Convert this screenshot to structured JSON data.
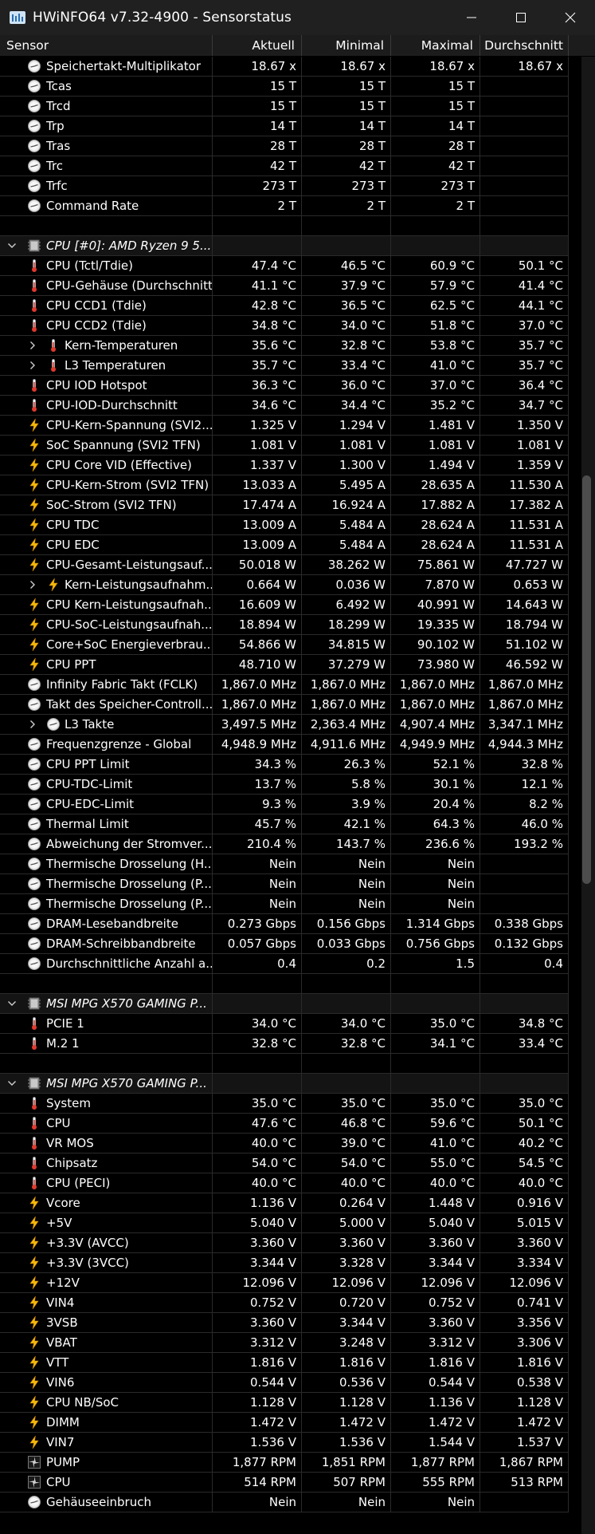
{
  "window": {
    "title": "HWiNFO64 v7.32-4900 - Sensorstatus"
  },
  "columns": [
    "Sensor",
    "Aktuell",
    "Minimal",
    "Maximal",
    "Durchschnitt"
  ],
  "rows": [
    {
      "type": "item",
      "icon": "gauge",
      "label": "Speichertakt-Multiplikator",
      "cur": "18.67 x",
      "min": "18.67 x",
      "max": "18.67 x",
      "avg": "18.67 x"
    },
    {
      "type": "item",
      "icon": "gauge",
      "label": "Tcas",
      "cur": "15 T",
      "min": "15 T",
      "max": "15 T",
      "avg": ""
    },
    {
      "type": "item",
      "icon": "gauge",
      "label": "Trcd",
      "cur": "15 T",
      "min": "15 T",
      "max": "15 T",
      "avg": ""
    },
    {
      "type": "item",
      "icon": "gauge",
      "label": "Trp",
      "cur": "14 T",
      "min": "14 T",
      "max": "14 T",
      "avg": ""
    },
    {
      "type": "item",
      "icon": "gauge",
      "label": "Tras",
      "cur": "28 T",
      "min": "28 T",
      "max": "28 T",
      "avg": ""
    },
    {
      "type": "item",
      "icon": "gauge",
      "label": "Trc",
      "cur": "42 T",
      "min": "42 T",
      "max": "42 T",
      "avg": ""
    },
    {
      "type": "item",
      "icon": "gauge",
      "label": "Trfc",
      "cur": "273 T",
      "min": "273 T",
      "max": "273 T",
      "avg": ""
    },
    {
      "type": "item",
      "icon": "gauge",
      "label": "Command Rate",
      "cur": "2 T",
      "min": "2 T",
      "max": "2 T",
      "avg": ""
    },
    {
      "type": "blank"
    },
    {
      "type": "group",
      "label": "CPU [#0]: AMD Ryzen 9 5..."
    },
    {
      "type": "item",
      "icon": "thermo",
      "label": "CPU (Tctl/Tdie)",
      "cur": "47.4 °C",
      "min": "46.5 °C",
      "max": "60.9 °C",
      "avg": "50.1 °C"
    },
    {
      "type": "item",
      "icon": "thermo",
      "label": "CPU-Gehäuse (Durchschnitt)",
      "cur": "41.1 °C",
      "min": "37.9 °C",
      "max": "57.9 °C",
      "avg": "41.4 °C"
    },
    {
      "type": "item",
      "icon": "thermo",
      "label": "CPU CCD1 (Tdie)",
      "cur": "42.8 °C",
      "min": "36.5 °C",
      "max": "62.5 °C",
      "avg": "44.1 °C"
    },
    {
      "type": "item",
      "icon": "thermo",
      "label": "CPU CCD2 (Tdie)",
      "cur": "34.8 °C",
      "min": "34.0 °C",
      "max": "51.8 °C",
      "avg": "37.0 °C"
    },
    {
      "type": "item",
      "icon": "thermo",
      "label": "Kern-Temperaturen",
      "sub": true,
      "cur": "35.6 °C",
      "min": "32.8 °C",
      "max": "53.8 °C",
      "avg": "35.7 °C"
    },
    {
      "type": "item",
      "icon": "thermo",
      "label": "L3 Temperaturen",
      "sub": true,
      "cur": "35.7 °C",
      "min": "33.4 °C",
      "max": "41.0 °C",
      "avg": "35.7 °C"
    },
    {
      "type": "item",
      "icon": "thermo",
      "label": "CPU IOD Hotspot",
      "cur": "36.3 °C",
      "min": "36.0 °C",
      "max": "37.0 °C",
      "avg": "36.4 °C"
    },
    {
      "type": "item",
      "icon": "thermo",
      "label": "CPU-IOD-Durchschnitt",
      "cur": "34.6 °C",
      "min": "34.4 °C",
      "max": "35.2 °C",
      "avg": "34.7 °C"
    },
    {
      "type": "item",
      "icon": "bolt",
      "label": "CPU-Kern-Spannung (SVI2...",
      "cur": "1.325 V",
      "min": "1.294 V",
      "max": "1.481 V",
      "avg": "1.350 V"
    },
    {
      "type": "item",
      "icon": "bolt",
      "label": "SoC Spannung (SVI2 TFN)",
      "cur": "1.081 V",
      "min": "1.081 V",
      "max": "1.081 V",
      "avg": "1.081 V"
    },
    {
      "type": "item",
      "icon": "bolt",
      "label": "CPU Core VID (Effective)",
      "cur": "1.337 V",
      "min": "1.300 V",
      "max": "1.494 V",
      "avg": "1.359 V"
    },
    {
      "type": "item",
      "icon": "bolt",
      "label": "CPU-Kern-Strom (SVI2 TFN)",
      "cur": "13.033 A",
      "min": "5.495 A",
      "max": "28.635 A",
      "avg": "11.530 A"
    },
    {
      "type": "item",
      "icon": "bolt",
      "label": "SoC-Strom (SVI2 TFN)",
      "cur": "17.474 A",
      "min": "16.924 A",
      "max": "17.882 A",
      "avg": "17.382 A"
    },
    {
      "type": "item",
      "icon": "bolt",
      "label": "CPU TDC",
      "cur": "13.009 A",
      "min": "5.484 A",
      "max": "28.624 A",
      "avg": "11.531 A"
    },
    {
      "type": "item",
      "icon": "bolt",
      "label": "CPU EDC",
      "cur": "13.009 A",
      "min": "5.484 A",
      "max": "28.624 A",
      "avg": "11.531 A"
    },
    {
      "type": "item",
      "icon": "bolt",
      "label": "CPU-Gesamt-Leistungsauf...",
      "cur": "50.018 W",
      "min": "38.262 W",
      "max": "75.861 W",
      "avg": "47.727 W"
    },
    {
      "type": "item",
      "icon": "bolt",
      "label": "Kern-Leistungsaufnahm...",
      "sub": true,
      "cur": "0.664 W",
      "min": "0.036 W",
      "max": "7.870 W",
      "avg": "0.653 W"
    },
    {
      "type": "item",
      "icon": "bolt",
      "label": "CPU Kern-Leistungsaufnah...",
      "cur": "16.609 W",
      "min": "6.492 W",
      "max": "40.991 W",
      "avg": "14.643 W"
    },
    {
      "type": "item",
      "icon": "bolt",
      "label": "CPU-SoC-Leistungsaufnah...",
      "cur": "18.894 W",
      "min": "18.299 W",
      "max": "19.335 W",
      "avg": "18.794 W"
    },
    {
      "type": "item",
      "icon": "bolt",
      "label": "Core+SoC Energieverbrau...",
      "cur": "54.866 W",
      "min": "34.815 W",
      "max": "90.102 W",
      "avg": "51.102 W"
    },
    {
      "type": "item",
      "icon": "bolt",
      "label": "CPU PPT",
      "cur": "48.710 W",
      "min": "37.279 W",
      "max": "73.980 W",
      "avg": "46.592 W"
    },
    {
      "type": "item",
      "icon": "gauge",
      "label": "Infinity Fabric Takt (FCLK)",
      "cur": "1,867.0 MHz",
      "min": "1,867.0 MHz",
      "max": "1,867.0 MHz",
      "avg": "1,867.0 MHz"
    },
    {
      "type": "item",
      "icon": "gauge",
      "label": "Takt des Speicher-Controll...",
      "cur": "1,867.0 MHz",
      "min": "1,867.0 MHz",
      "max": "1,867.0 MHz",
      "avg": "1,867.0 MHz"
    },
    {
      "type": "item",
      "icon": "gauge",
      "label": "L3 Takte",
      "sub": true,
      "cur": "3,497.5 MHz",
      "min": "2,363.4 MHz",
      "max": "4,907.4 MHz",
      "avg": "3,347.1 MHz"
    },
    {
      "type": "item",
      "icon": "gauge",
      "label": "Frequenzgrenze - Global",
      "cur": "4,948.9 MHz",
      "min": "4,911.6 MHz",
      "max": "4,949.9 MHz",
      "avg": "4,944.3 MHz"
    },
    {
      "type": "item",
      "icon": "gauge",
      "label": "CPU PPT Limit",
      "cur": "34.3 %",
      "min": "26.3 %",
      "max": "52.1 %",
      "avg": "32.8 %"
    },
    {
      "type": "item",
      "icon": "gauge",
      "label": "CPU-TDC-Limit",
      "cur": "13.7 %",
      "min": "5.8 %",
      "max": "30.1 %",
      "avg": "12.1 %"
    },
    {
      "type": "item",
      "icon": "gauge",
      "label": "CPU-EDC-Limit",
      "cur": "9.3 %",
      "min": "3.9 %",
      "max": "20.4 %",
      "avg": "8.2 %"
    },
    {
      "type": "item",
      "icon": "gauge",
      "label": "Thermal Limit",
      "cur": "45.7 %",
      "min": "42.1 %",
      "max": "64.3 %",
      "avg": "46.0 %"
    },
    {
      "type": "item",
      "icon": "gauge",
      "label": "Abweichung der Stromver...",
      "cur": "210.4 %",
      "min": "143.7 %",
      "max": "236.6 %",
      "avg": "193.2 %"
    },
    {
      "type": "item",
      "icon": "gauge",
      "label": "Thermische Drosselung (H...",
      "cur": "Nein",
      "min": "Nein",
      "max": "Nein",
      "avg": ""
    },
    {
      "type": "item",
      "icon": "gauge",
      "label": "Thermische Drosselung (P...",
      "cur": "Nein",
      "min": "Nein",
      "max": "Nein",
      "avg": ""
    },
    {
      "type": "item",
      "icon": "gauge",
      "label": "Thermische Drosselung (P...",
      "cur": "Nein",
      "min": "Nein",
      "max": "Nein",
      "avg": ""
    },
    {
      "type": "item",
      "icon": "gauge",
      "label": "DRAM-Lesebandbreite",
      "cur": "0.273 Gbps",
      "min": "0.156 Gbps",
      "max": "1.314 Gbps",
      "avg": "0.338 Gbps"
    },
    {
      "type": "item",
      "icon": "gauge",
      "label": "DRAM-Schreibbandbreite",
      "cur": "0.057 Gbps",
      "min": "0.033 Gbps",
      "max": "0.756 Gbps",
      "avg": "0.132 Gbps"
    },
    {
      "type": "item",
      "icon": "gauge",
      "label": "Durchschnittliche Anzahl a...",
      "cur": "0.4",
      "min": "0.2",
      "max": "1.5",
      "avg": "0.4"
    },
    {
      "type": "blank"
    },
    {
      "type": "group",
      "label": "MSI MPG X570 GAMING P..."
    },
    {
      "type": "item",
      "icon": "thermo",
      "label": "PCIE 1",
      "cur": "34.0 °C",
      "min": "34.0 °C",
      "max": "35.0 °C",
      "avg": "34.8 °C"
    },
    {
      "type": "item",
      "icon": "thermo",
      "label": "M.2 1",
      "cur": "32.8 °C",
      "min": "32.8 °C",
      "max": "34.1 °C",
      "avg": "33.4 °C"
    },
    {
      "type": "blank"
    },
    {
      "type": "group",
      "label": "MSI MPG X570 GAMING P..."
    },
    {
      "type": "item",
      "icon": "thermo",
      "label": "System",
      "cur": "35.0 °C",
      "min": "35.0 °C",
      "max": "35.0 °C",
      "avg": "35.0 °C"
    },
    {
      "type": "item",
      "icon": "thermo",
      "label": "CPU",
      "cur": "47.6 °C",
      "min": "46.8 °C",
      "max": "59.6 °C",
      "avg": "50.1 °C"
    },
    {
      "type": "item",
      "icon": "thermo",
      "label": "VR MOS",
      "cur": "40.0 °C",
      "min": "39.0 °C",
      "max": "41.0 °C",
      "avg": "40.2 °C"
    },
    {
      "type": "item",
      "icon": "thermo",
      "label": "Chipsatz",
      "cur": "54.0 °C",
      "min": "54.0 °C",
      "max": "55.0 °C",
      "avg": "54.5 °C"
    },
    {
      "type": "item",
      "icon": "thermo",
      "label": "CPU (PECI)",
      "cur": "40.0 °C",
      "min": "40.0 °C",
      "max": "40.0 °C",
      "avg": "40.0 °C"
    },
    {
      "type": "item",
      "icon": "bolt",
      "label": "Vcore",
      "cur": "1.136 V",
      "min": "0.264 V",
      "max": "1.448 V",
      "avg": "0.916 V"
    },
    {
      "type": "item",
      "icon": "bolt",
      "label": "+5V",
      "cur": "5.040 V",
      "min": "5.000 V",
      "max": "5.040 V",
      "avg": "5.015 V"
    },
    {
      "type": "item",
      "icon": "bolt",
      "label": "+3.3V (AVCC)",
      "cur": "3.360 V",
      "min": "3.360 V",
      "max": "3.360 V",
      "avg": "3.360 V"
    },
    {
      "type": "item",
      "icon": "bolt",
      "label": "+3.3V (3VCC)",
      "cur": "3.344 V",
      "min": "3.328 V",
      "max": "3.344 V",
      "avg": "3.334 V"
    },
    {
      "type": "item",
      "icon": "bolt",
      "label": "+12V",
      "cur": "12.096 V",
      "min": "12.096 V",
      "max": "12.096 V",
      "avg": "12.096 V"
    },
    {
      "type": "item",
      "icon": "bolt",
      "label": "VIN4",
      "cur": "0.752 V",
      "min": "0.720 V",
      "max": "0.752 V",
      "avg": "0.741 V"
    },
    {
      "type": "item",
      "icon": "bolt",
      "label": "3VSB",
      "cur": "3.360 V",
      "min": "3.344 V",
      "max": "3.360 V",
      "avg": "3.356 V"
    },
    {
      "type": "item",
      "icon": "bolt",
      "label": "VBAT",
      "cur": "3.312 V",
      "min": "3.248 V",
      "max": "3.312 V",
      "avg": "3.306 V"
    },
    {
      "type": "item",
      "icon": "bolt",
      "label": "VTT",
      "cur": "1.816 V",
      "min": "1.816 V",
      "max": "1.816 V",
      "avg": "1.816 V"
    },
    {
      "type": "item",
      "icon": "bolt",
      "label": "VIN6",
      "cur": "0.544 V",
      "min": "0.536 V",
      "max": "0.544 V",
      "avg": "0.538 V"
    },
    {
      "type": "item",
      "icon": "bolt",
      "label": "CPU NB/SoC",
      "cur": "1.128 V",
      "min": "1.128 V",
      "max": "1.136 V",
      "avg": "1.128 V"
    },
    {
      "type": "item",
      "icon": "bolt",
      "label": "DIMM",
      "cur": "1.472 V",
      "min": "1.472 V",
      "max": "1.472 V",
      "avg": "1.472 V"
    },
    {
      "type": "item",
      "icon": "bolt",
      "label": "VIN7",
      "cur": "1.536 V",
      "min": "1.536 V",
      "max": "1.544 V",
      "avg": "1.537 V"
    },
    {
      "type": "item",
      "icon": "fan",
      "label": "PUMP",
      "cur": "1,877 RPM",
      "min": "1,851 RPM",
      "max": "1,877 RPM",
      "avg": "1,867 RPM"
    },
    {
      "type": "item",
      "icon": "fan",
      "label": "CPU",
      "cur": "514 RPM",
      "min": "507 RPM",
      "max": "555 RPM",
      "avg": "513 RPM"
    },
    {
      "type": "item",
      "icon": "gauge",
      "label": "Gehäuseeinbruch",
      "cur": "Nein",
      "min": "Nein",
      "max": "Nein",
      "avg": ""
    }
  ]
}
